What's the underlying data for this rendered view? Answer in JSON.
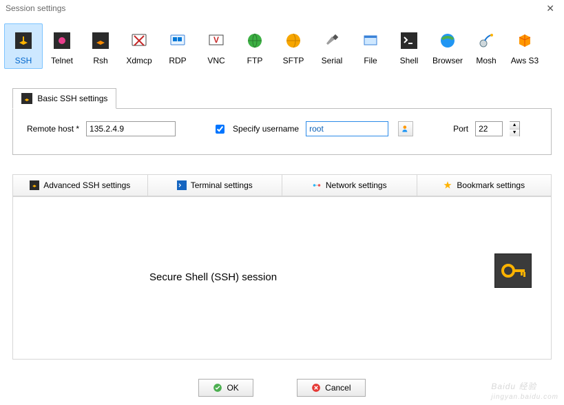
{
  "window": {
    "title": "Session settings"
  },
  "session_types": [
    {
      "id": "ssh",
      "label": "SSH",
      "selected": true
    },
    {
      "id": "telnet",
      "label": "Telnet"
    },
    {
      "id": "rsh",
      "label": "Rsh"
    },
    {
      "id": "xdmcp",
      "label": "Xdmcp"
    },
    {
      "id": "rdp",
      "label": "RDP"
    },
    {
      "id": "vnc",
      "label": "VNC"
    },
    {
      "id": "ftp",
      "label": "FTP"
    },
    {
      "id": "sftp",
      "label": "SFTP"
    },
    {
      "id": "serial",
      "label": "Serial"
    },
    {
      "id": "file",
      "label": "File"
    },
    {
      "id": "shell",
      "label": "Shell"
    },
    {
      "id": "browser",
      "label": "Browser"
    },
    {
      "id": "mosh",
      "label": "Mosh"
    },
    {
      "id": "awss3",
      "label": "Aws S3"
    }
  ],
  "basic_tab": {
    "label": "Basic SSH settings"
  },
  "form": {
    "remote_host_label": "Remote host *",
    "remote_host_value": "135.2.4.9",
    "specify_username_label": "Specify username",
    "specify_username_checked": true,
    "username_value": "root",
    "port_label": "Port",
    "port_value": "22"
  },
  "settings_tabs": {
    "advanced": "Advanced SSH settings",
    "terminal": "Terminal settings",
    "network": "Network settings",
    "bookmark": "Bookmark settings"
  },
  "content": {
    "session_title": "Secure Shell (SSH) session"
  },
  "buttons": {
    "ok": "OK",
    "cancel": "Cancel"
  },
  "watermark": {
    "main": "Baidu 经验",
    "sub": "jingyan.baidu.com"
  }
}
